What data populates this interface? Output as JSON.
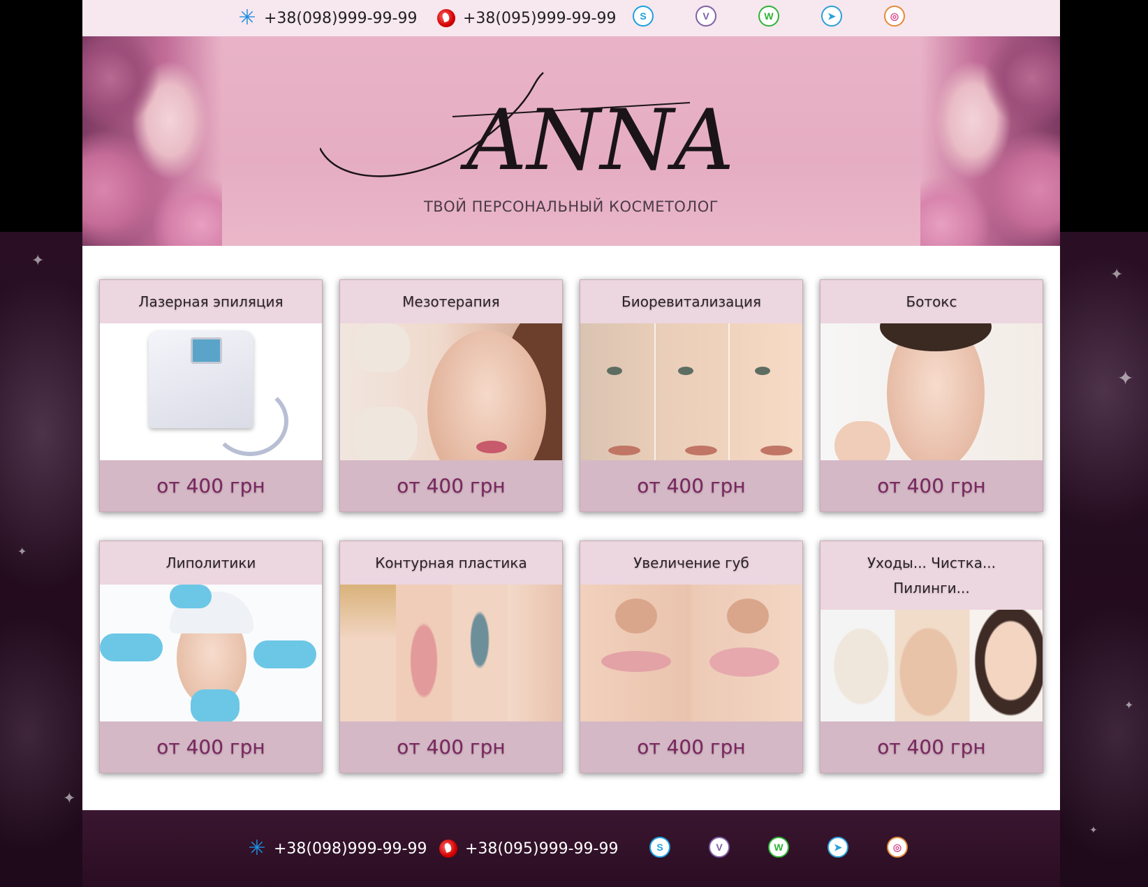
{
  "contacts": {
    "kyivstar_phone": "+38(098)999-99-99",
    "vodafone_phone": "+38(095)999-99-99"
  },
  "social": {
    "skype": "S",
    "viber": "V",
    "whatsapp": "W",
    "telegram": "➤",
    "instagram": "◎"
  },
  "banner": {
    "logo_text": "ANNA",
    "tagline": "ТВОЙ ПЕРСОНАЛЬНЫЙ КОСМЕТОЛОГ"
  },
  "services": [
    {
      "title": "Лазерная эпиляция",
      "price": "от 400 грн"
    },
    {
      "title": "Мезотерапия",
      "price": "от 400 грн"
    },
    {
      "title": "Биоревитализация",
      "price": "от 400 грн"
    },
    {
      "title": "Ботокс",
      "price": "от 400 грн"
    },
    {
      "title": "Липолитики",
      "price": "от 400 грн"
    },
    {
      "title": "Контурная пластика",
      "price": "от 400 грн"
    },
    {
      "title": "Увеличение губ",
      "price": "от 400 грн"
    },
    {
      "title": "Уходы... Чистка... Пилинги...",
      "price": "от 400 грн"
    }
  ],
  "colors": {
    "topbar_bg": "#f7e7ee",
    "banner_bg": "#e9b3c7",
    "card_title_bg": "#ecd6df",
    "card_price_bg": "#d4b8c5",
    "price_text": "#7a2760",
    "footer_bg": "#2a0d22",
    "skype": "#1aa0e0",
    "viber": "#7d5fa8",
    "whatsapp": "#2fb336",
    "telegram": "#2aa0da",
    "instagram": "#d6498a"
  }
}
